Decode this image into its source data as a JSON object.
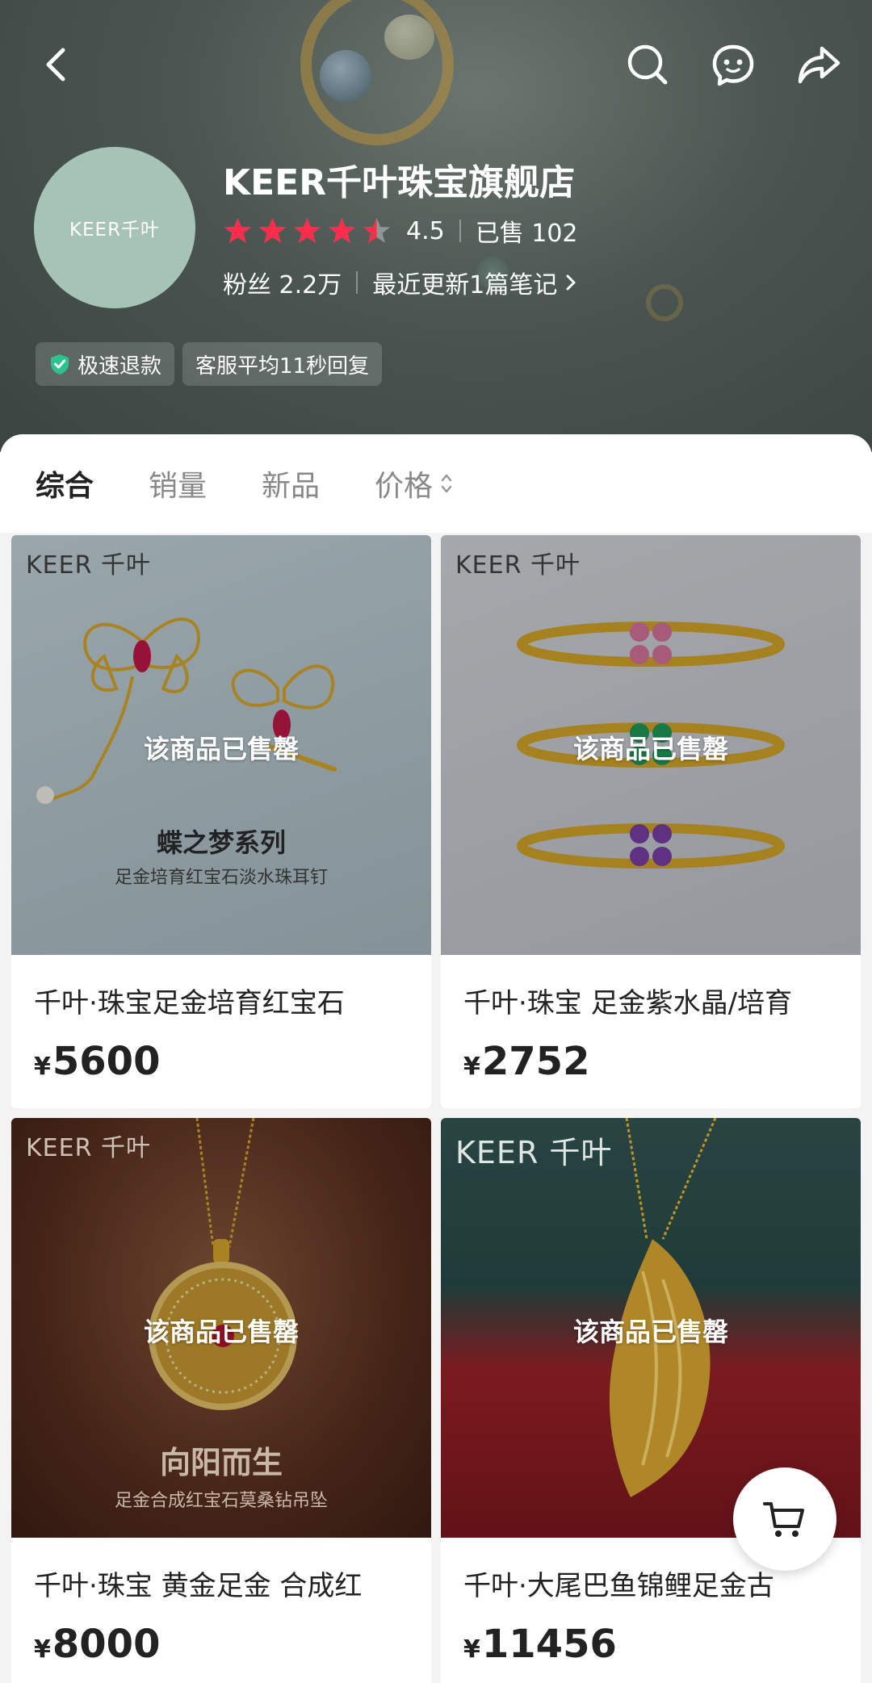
{
  "header": {
    "store_name": "KEER千叶珠宝旗舰店",
    "avatar_text": "KEER千叶",
    "rating": "4.5",
    "stars_filled": 4.5,
    "sold": "已售 102",
    "fans": "粉丝 2.2万",
    "recent_notes": "最近更新1篇笔记",
    "badges": [
      "极速退款",
      "客服平均11秒回复"
    ]
  },
  "tabs": [
    {
      "label": "综合"
    },
    {
      "label": "销量"
    },
    {
      "label": "新品"
    },
    {
      "label": "价格"
    }
  ],
  "products": [
    {
      "brand": "KEER 千叶",
      "status": "该商品已售罄",
      "caption_title": "蝶之梦系列",
      "caption_sub": "足金培育红宝石淡水珠耳钉",
      "title": "千叶·珠宝足金培育红宝石",
      "currency": "¥",
      "price": "5600"
    },
    {
      "brand": "KEER 千叶",
      "status": "该商品已售罄",
      "caption_title": "",
      "caption_sub": "",
      "title": "千叶·珠宝 足金紫水晶/培育",
      "currency": "¥",
      "price": "2752"
    },
    {
      "brand": "KEER 千叶",
      "status": "该商品已售罄",
      "caption_title": "向阳而生",
      "caption_sub": "足金合成红宝石莫桑钻吊坠",
      "title": "千叶·珠宝 黄金足金 合成红",
      "currency": "¥",
      "price": "8000"
    },
    {
      "brand": "KEER 千叶",
      "status": "该商品已售罄",
      "caption_title": "",
      "caption_sub": "",
      "title": "千叶·大尾巴鱼锦鲤足金古",
      "currency": "¥",
      "price": "11456"
    }
  ],
  "colors": {
    "star": "#ff2d4b",
    "gold": "#d9a82c",
    "badge_check": "#2fc18e"
  }
}
